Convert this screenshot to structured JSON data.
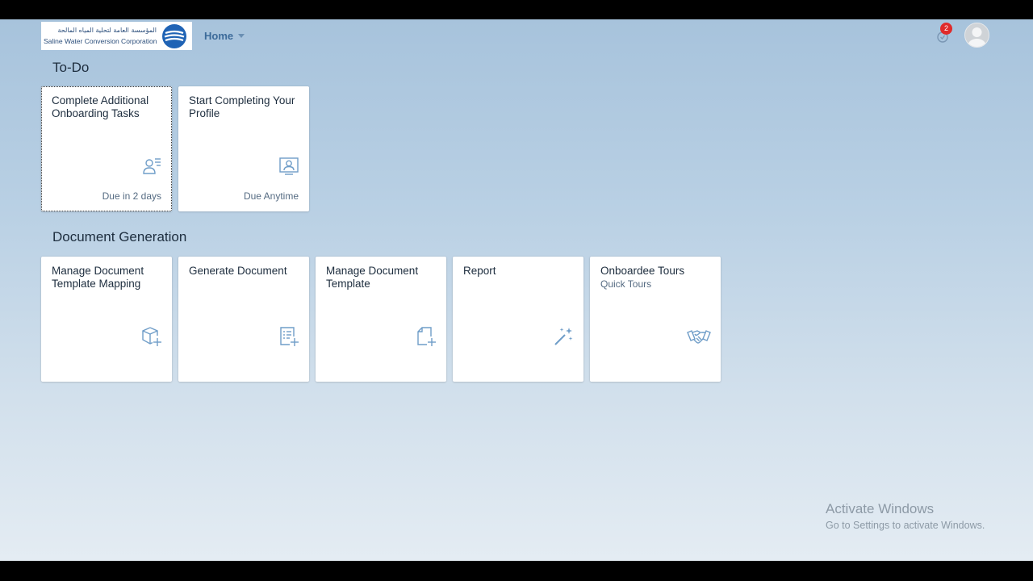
{
  "header": {
    "logo_arabic": "المؤسسة العامة لتحلية المياه المالحة",
    "logo_english": "Saline Water Conversion Corporation",
    "home_label": "Home",
    "notification_count": "2"
  },
  "todo": {
    "title": "To-Do",
    "tiles": [
      {
        "title": "Complete Additional Onboarding Tasks",
        "icon": "user-list-icon",
        "footer": "Due in 2 days"
      },
      {
        "title": "Start Completing Your Profile",
        "icon": "profile-card-icon",
        "footer": "Due Anytime"
      }
    ]
  },
  "docgen": {
    "title": "Document Generation",
    "tiles": [
      {
        "title": "Manage Document Template Mapping",
        "icon": "cube-add-icon"
      },
      {
        "title": "Generate Document",
        "icon": "document-list-add-icon"
      },
      {
        "title": "Manage Document Template",
        "icon": "document-add-icon"
      },
      {
        "title": "Report",
        "icon": "magic-wand-icon"
      },
      {
        "title": "Onboardee Tours",
        "subtitle": "Quick Tours",
        "icon": "handshake-icon"
      }
    ]
  },
  "watermark": {
    "line1": "Activate Windows",
    "line2": "Go to Settings to activate Windows."
  },
  "colors": {
    "accent": "#3c6b9a",
    "icon": "#6f9dc8",
    "badge": "#e02a2a",
    "text": "#1d2d3e"
  }
}
